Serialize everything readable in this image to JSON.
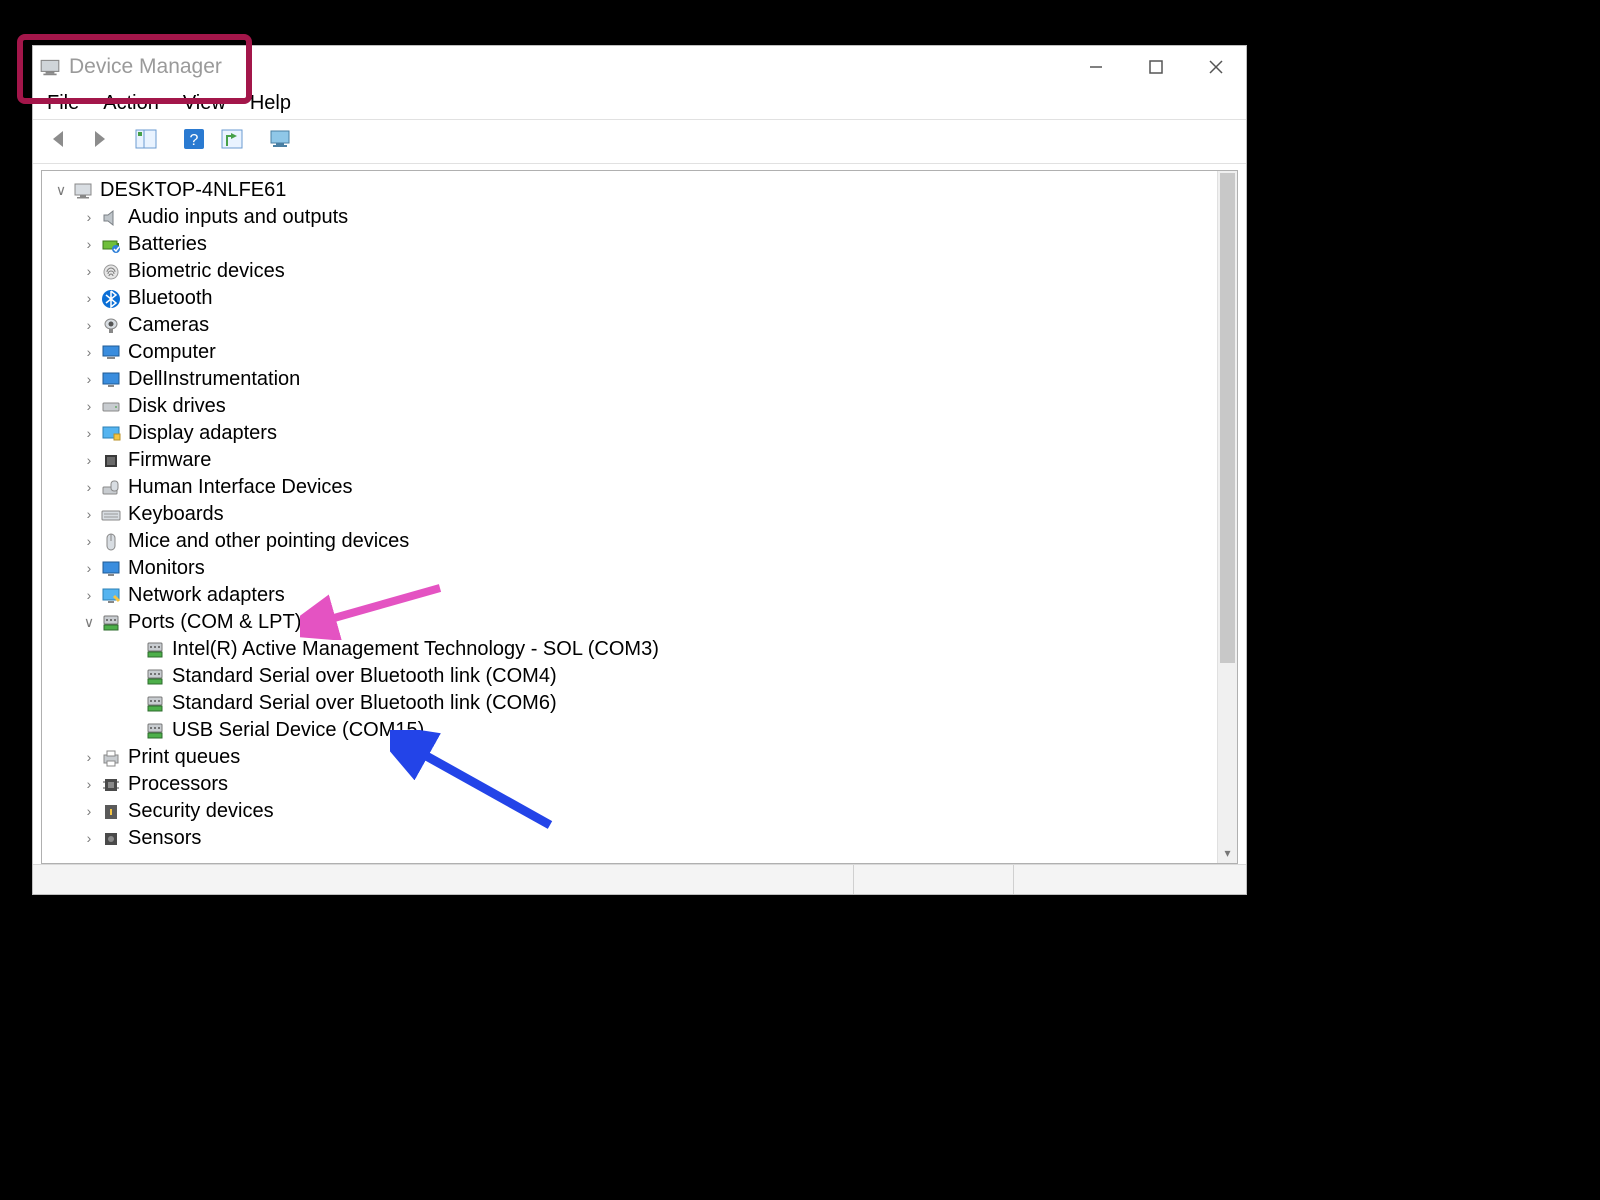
{
  "window": {
    "title": "Device Manager"
  },
  "menus": {
    "file": "File",
    "action": "Action",
    "view": "View",
    "help": "Help"
  },
  "root_node": "DESKTOP-4NLFE61",
  "categories": [
    {
      "label": "Audio inputs and outputs",
      "icon": "speaker"
    },
    {
      "label": "Batteries",
      "icon": "battery"
    },
    {
      "label": "Biometric devices",
      "icon": "fingerprint"
    },
    {
      "label": "Bluetooth",
      "icon": "bluetooth"
    },
    {
      "label": "Cameras",
      "icon": "camera"
    },
    {
      "label": "Computer",
      "icon": "computer"
    },
    {
      "label": "DellInstrumentation",
      "icon": "monitor"
    },
    {
      "label": "Disk drives",
      "icon": "disk"
    },
    {
      "label": "Display adapters",
      "icon": "display"
    },
    {
      "label": "Firmware",
      "icon": "chip"
    },
    {
      "label": "Human Interface Devices",
      "icon": "hid"
    },
    {
      "label": "Keyboards",
      "icon": "keyboard"
    },
    {
      "label": "Mice and other pointing devices",
      "icon": "mouse"
    },
    {
      "label": "Monitors",
      "icon": "monitor2"
    },
    {
      "label": "Network adapters",
      "icon": "network"
    },
    {
      "label": "Ports (COM & LPT)",
      "icon": "port",
      "expanded": true
    },
    {
      "label": "Print queues",
      "icon": "printer"
    },
    {
      "label": "Processors",
      "icon": "cpu"
    },
    {
      "label": "Security devices",
      "icon": "security"
    },
    {
      "label": "Sensors",
      "icon": "sensor"
    }
  ],
  "ports_children": [
    {
      "label": "Intel(R) Active Management Technology - SOL (COM3)"
    },
    {
      "label": "Standard Serial over Bluetooth link (COM4)"
    },
    {
      "label": "Standard Serial over Bluetooth link (COM6)"
    },
    {
      "label": "USB Serial Device (COM15)"
    }
  ],
  "annotations": {
    "red_highlight": "Window title Device Manager circled",
    "pink_arrow_target": "Ports (COM & LPT)",
    "blue_arrow_target": "USB Serial Device (COM15)"
  }
}
